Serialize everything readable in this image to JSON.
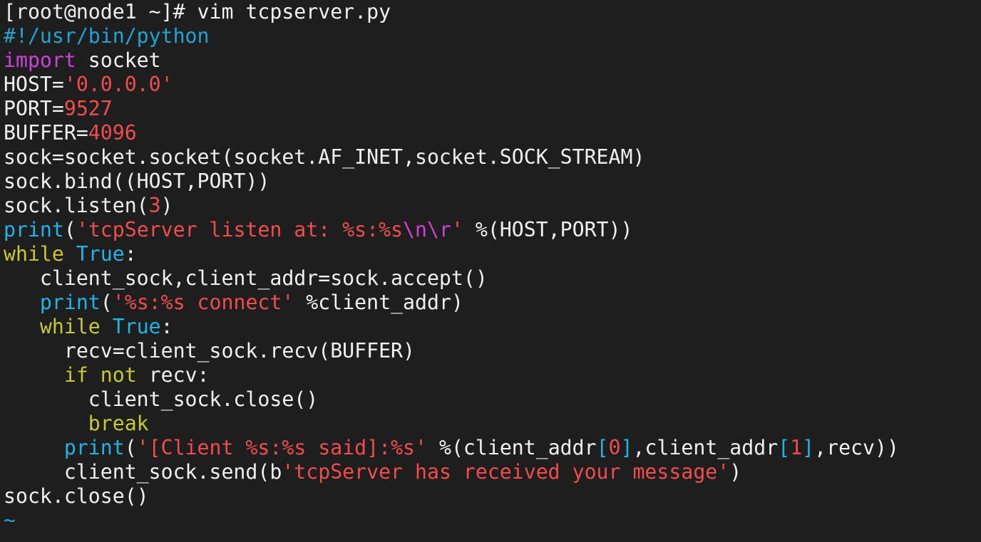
{
  "colors": {
    "background": "#1e1e1e",
    "normal": "#f0f0f0",
    "comment": "#21a3d4",
    "keyword": "#d040d8",
    "string": "#f24c4c",
    "number": "#f24c4c",
    "builtin": "#21b4e8",
    "statement": "#c8c832",
    "escape": "#d040d8",
    "tilde": "#21a3d4"
  },
  "lines": [
    [
      {
        "t": "[root@node1 ~]# vim tcpserver.py",
        "c": "normal"
      }
    ],
    [
      {
        "t": "#!/usr/bin/python",
        "c": "comment"
      }
    ],
    [
      {
        "t": "import",
        "c": "keyword"
      },
      {
        "t": " socket",
        "c": "normal"
      }
    ],
    [
      {
        "t": "HOST=",
        "c": "normal"
      },
      {
        "t": "'0.0.0.0'",
        "c": "string"
      }
    ],
    [
      {
        "t": "PORT=",
        "c": "normal"
      },
      {
        "t": "9527",
        "c": "number"
      }
    ],
    [
      {
        "t": "BUFFER=",
        "c": "normal"
      },
      {
        "t": "4096",
        "c": "number"
      }
    ],
    [
      {
        "t": "sock=socket.socket(socket.AF_INET,socket.SOCK_STREAM)",
        "c": "normal"
      }
    ],
    [
      {
        "t": "sock.bind((HOST,PORT))",
        "c": "normal"
      }
    ],
    [
      {
        "t": "sock.listen(",
        "c": "normal"
      },
      {
        "t": "3",
        "c": "number"
      },
      {
        "t": ")",
        "c": "normal"
      }
    ],
    [
      {
        "t": "print",
        "c": "builtin"
      },
      {
        "t": "(",
        "c": "normal"
      },
      {
        "t": "'tcpServer listen at: %s:%s",
        "c": "string"
      },
      {
        "t": "\\n\\r",
        "c": "escape"
      },
      {
        "t": "'",
        "c": "string"
      },
      {
        "t": " %(HOST,PORT))",
        "c": "normal"
      }
    ],
    [
      {
        "t": "while",
        "c": "statement"
      },
      {
        "t": " ",
        "c": "normal"
      },
      {
        "t": "True",
        "c": "builtin"
      },
      {
        "t": ":",
        "c": "normal"
      }
    ],
    [
      {
        "t": "   client_sock,client_addr=sock.accept()",
        "c": "normal"
      }
    ],
    [
      {
        "t": "   ",
        "c": "normal"
      },
      {
        "t": "print",
        "c": "builtin"
      },
      {
        "t": "(",
        "c": "normal"
      },
      {
        "t": "'%s:%s connect'",
        "c": "string"
      },
      {
        "t": " %client_addr)",
        "c": "normal"
      }
    ],
    [
      {
        "t": "   ",
        "c": "normal"
      },
      {
        "t": "while",
        "c": "statement"
      },
      {
        "t": " ",
        "c": "normal"
      },
      {
        "t": "True",
        "c": "builtin"
      },
      {
        "t": ":",
        "c": "normal"
      }
    ],
    [
      {
        "t": "     recv=client_sock.recv(BUFFER)",
        "c": "normal"
      }
    ],
    [
      {
        "t": "     ",
        "c": "normal"
      },
      {
        "t": "if",
        "c": "statement"
      },
      {
        "t": " ",
        "c": "normal"
      },
      {
        "t": "not",
        "c": "statement"
      },
      {
        "t": " recv:",
        "c": "normal"
      }
    ],
    [
      {
        "t": "       client_sock.close()",
        "c": "normal"
      }
    ],
    [
      {
        "t": "       ",
        "c": "normal"
      },
      {
        "t": "break",
        "c": "statement"
      }
    ],
    [
      {
        "t": "     ",
        "c": "normal"
      },
      {
        "t": "print",
        "c": "builtin"
      },
      {
        "t": "(",
        "c": "normal"
      },
      {
        "t": "'[Client %s:%s said]:%s'",
        "c": "string"
      },
      {
        "t": " %(client_addr",
        "c": "normal"
      },
      {
        "t": "[",
        "c": "builtin"
      },
      {
        "t": "0",
        "c": "number"
      },
      {
        "t": "]",
        "c": "builtin"
      },
      {
        "t": ",client_addr",
        "c": "normal"
      },
      {
        "t": "[",
        "c": "builtin"
      },
      {
        "t": "1",
        "c": "number"
      },
      {
        "t": "]",
        "c": "builtin"
      },
      {
        "t": ",recv))",
        "c": "normal"
      }
    ],
    [
      {
        "t": "     client_sock.send(b",
        "c": "normal"
      },
      {
        "t": "'tcpServer has received your message'",
        "c": "string"
      },
      {
        "t": ")",
        "c": "normal"
      }
    ],
    [
      {
        "t": "sock.close()",
        "c": "normal"
      }
    ],
    [
      {
        "t": "~",
        "c": "tilde"
      }
    ]
  ]
}
